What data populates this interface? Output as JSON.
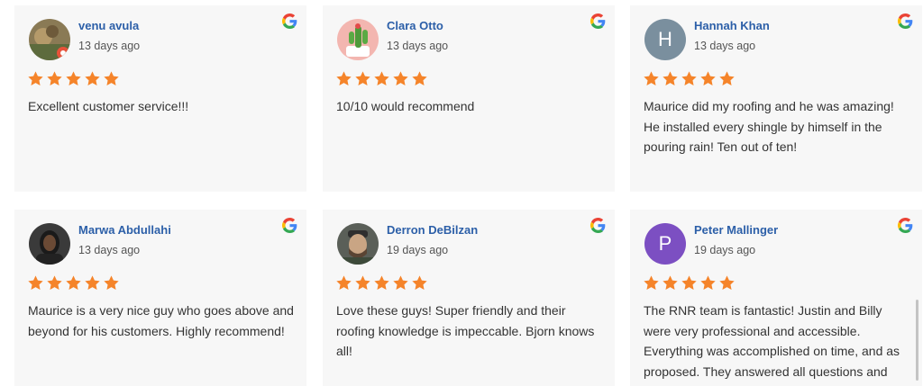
{
  "reviews": [
    {
      "name": "venu avula",
      "date": "13 days ago",
      "rating": 5,
      "text": "Excellent customer service!!!",
      "avatar": {
        "type": "photo",
        "icon": "user-photo-avatar"
      }
    },
    {
      "name": "Clara Otto",
      "date": "13 days ago",
      "rating": 5,
      "text": "10/10 would recommend",
      "avatar": {
        "type": "photo",
        "icon": "cactus-photo-avatar"
      }
    },
    {
      "name": "Hannah Khan",
      "date": "13 days ago",
      "rating": 5,
      "text": "Maurice did my roofing and he was amazing! He installed every shingle by himself in the pouring rain! Ten out of ten!",
      "avatar": {
        "type": "letter",
        "letter": "H",
        "color": "#7a8f9e"
      }
    },
    {
      "name": "Marwa Abdullahi",
      "date": "13 days ago",
      "rating": 5,
      "text": "Maurice is a very nice guy who goes above and beyond for his customers. Highly recommend!",
      "avatar": {
        "type": "photo",
        "icon": "user-photo-avatar"
      }
    },
    {
      "name": "Derron DeBilzan",
      "date": "19 days ago",
      "rating": 5,
      "text": "Love these guys! Super friendly and their roofing knowledge is impeccable. Bjorn knows all!",
      "avatar": {
        "type": "photo",
        "icon": "user-photo-avatar"
      }
    },
    {
      "name": "Peter Mallinger",
      "date": "19 days ago",
      "rating": 5,
      "text": "The RNR team is fantastic!  Justin and Billy were very professional and accessible. Everything was accomplished on time, and as proposed.  They answered all questions and",
      "avatar": {
        "type": "letter",
        "letter": "P",
        "color": "#7c4fc2"
      }
    }
  ],
  "colors": {
    "star": "#f5842a",
    "name": "#2c5fa8",
    "card_bg": "#f7f7f7"
  },
  "source_icon": "google-g-icon"
}
